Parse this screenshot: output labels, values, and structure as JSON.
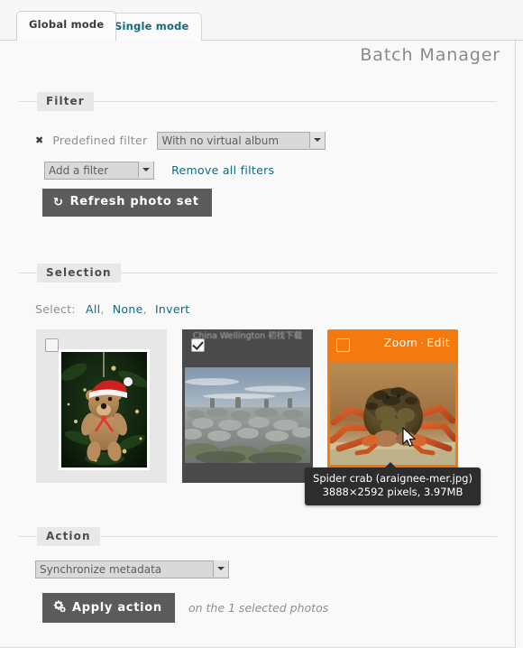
{
  "page": {
    "title": "Batch Manager"
  },
  "tabs": [
    {
      "label": "Global mode",
      "active": true
    },
    {
      "label": "Single mode",
      "active": false
    }
  ],
  "filter": {
    "legend": "Filter",
    "remove_mark": "✖",
    "predefined_label": "Predefined filter",
    "predefined_value": "With no virtual album",
    "add_filter_value": "Add a filter",
    "remove_all_label": "Remove all filters",
    "refresh_icon": "↻",
    "refresh_label": "Refresh photo set"
  },
  "selection": {
    "legend": "Selection",
    "select_label": "Select:",
    "all_label": "All",
    "none_label": "None",
    "invert_label": "Invert",
    "sep": ",",
    "thumbnails": [
      {
        "name": "teddy-bear",
        "caption": "",
        "checked": false,
        "selected": false,
        "hovered": false
      },
      {
        "name": "stone-cairns",
        "caption": "China Wellington 初找下载",
        "checked": true,
        "selected": true,
        "hovered": false
      },
      {
        "name": "spider-crab",
        "caption": "",
        "checked": false,
        "selected": false,
        "hovered": true,
        "zoom_label": "Zoom",
        "action_sep": "·",
        "edit_label": "Edit"
      }
    ],
    "tooltip": {
      "line1": "Spider crab (araignee-mer.jpg)",
      "line2": "3888×2592 pixels, 3.97MB"
    }
  },
  "action": {
    "legend": "Action",
    "selected_action": "Synchronize metadata",
    "apply_icon": "⚙",
    "apply_label": "Apply action",
    "apply_suffix": "on the 1 selected photos"
  },
  "colors": {
    "accent_orange": "#f4790e",
    "link_teal": "#15687e",
    "button_grey": "#5b5b5b",
    "selected_thumb_bg": "#4a4a4a",
    "tooltip_bg": "#2d2d2d"
  }
}
